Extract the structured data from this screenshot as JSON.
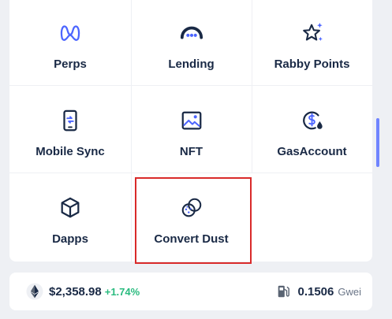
{
  "menu": {
    "items": [
      {
        "label": "Perps",
        "icon": "perps-icon"
      },
      {
        "label": "Lending",
        "icon": "lending-icon"
      },
      {
        "label": "Rabby Points",
        "icon": "rabby-points-icon"
      },
      {
        "label": "Mobile Sync",
        "icon": "mobile-sync-icon"
      },
      {
        "label": "NFT",
        "icon": "nft-icon"
      },
      {
        "label": "GasAccount",
        "icon": "gas-account-icon"
      },
      {
        "label": "Dapps",
        "icon": "dapps-icon"
      },
      {
        "label": "Convert Dust",
        "icon": "convert-dust-icon"
      }
    ]
  },
  "footer": {
    "eth_price": "$2,358.98",
    "eth_change": "+1.74%",
    "gas_price": "0.1506",
    "gas_unit": "Gwei"
  },
  "colors": {
    "accent": "#4c65ff",
    "text": "#192945",
    "positive": "#2abb7f",
    "highlight_border": "#d92a2a"
  }
}
